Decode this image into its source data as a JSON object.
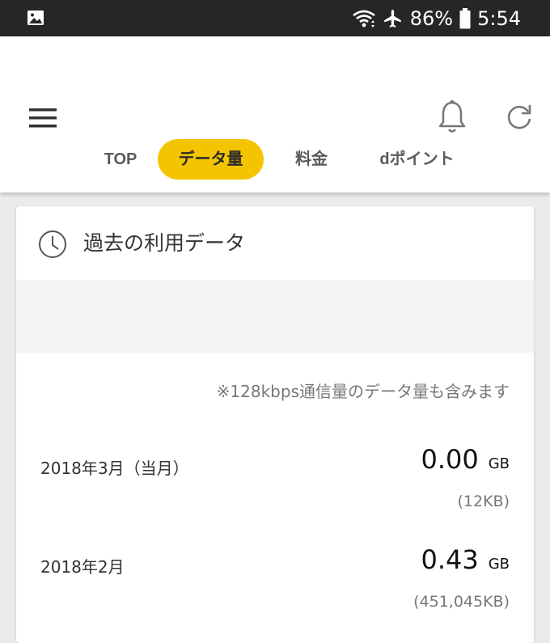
{
  "status_bar": {
    "battery_percent": "86%",
    "time": "5:54",
    "icons": [
      "gallery-icon",
      "wifi-icon",
      "airplane-icon",
      "battery-icon"
    ]
  },
  "app_bar": {
    "icons": [
      "menu-icon",
      "bell-icon",
      "refresh-icon"
    ],
    "tabs": [
      {
        "label": "TOP",
        "active": false
      },
      {
        "label": "データ量",
        "active": true
      },
      {
        "label": "料金",
        "active": false
      },
      {
        "label": "dポイント",
        "active": false
      }
    ]
  },
  "card": {
    "title": "過去の利用データ",
    "note": "※128kbps通信量のデータ量も含みます",
    "rows": [
      {
        "month": "2018年3月（当月）",
        "value": "0.00",
        "unit": "GB",
        "sub": "(12KB)"
      },
      {
        "month": "2018年2月",
        "value": "0.43",
        "unit": "GB",
        "sub": "(451,045KB)"
      }
    ]
  },
  "colors": {
    "accent": "#f5c400",
    "status_bar": "#262626"
  }
}
